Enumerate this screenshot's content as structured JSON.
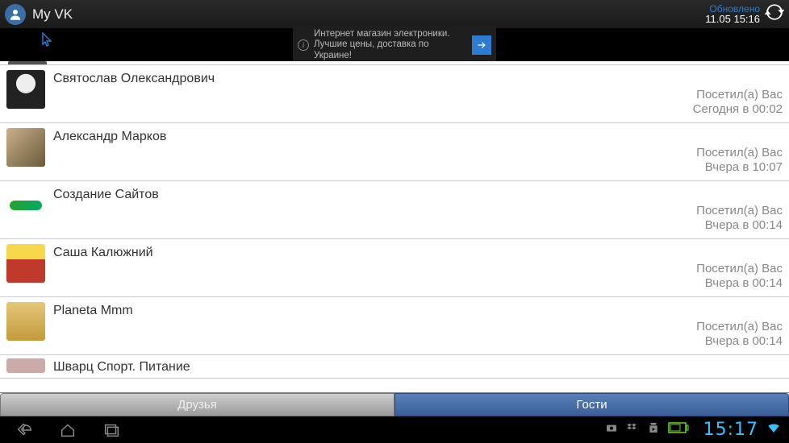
{
  "header": {
    "title": "My VK",
    "update_label": "Обновлено",
    "update_time": "11.05 15:16"
  },
  "ad": {
    "text": "Интернет магазин электроники. Лучшие цены, доставка по Украине!"
  },
  "visitors": [
    {
      "name": "Святослав Олександрович",
      "action": "Посетил(а) Вас",
      "when": "Сегодня в 00:02",
      "avatar_desc": "helmet-avatar"
    },
    {
      "name": "Александр Марков",
      "action": "Посетил(а) Вас",
      "when": "Вчера в 10:07",
      "avatar_desc": "couple-photo-avatar"
    },
    {
      "name": "Создание Сайтов",
      "action": "Посетил(а) Вас",
      "when": "Вчера в 00:14",
      "avatar_desc": "green-logo-avatar"
    },
    {
      "name": "Саша Калюжний",
      "action": "Посетил(а) Вас",
      "when": "Вчера в 00:14",
      "avatar_desc": "yellow-car-avatar"
    },
    {
      "name": "Planeta Mmm",
      "action": "Посетил(а) Вас",
      "when": "Вчера в 00:14",
      "avatar_desc": "gold-badge-avatar"
    }
  ],
  "partial_next_name": "Шварц Спорт. Питание",
  "tabs": {
    "friends": "Друзья",
    "guests": "Гости",
    "active": "guests"
  },
  "navbar": {
    "clock": "15:17"
  }
}
